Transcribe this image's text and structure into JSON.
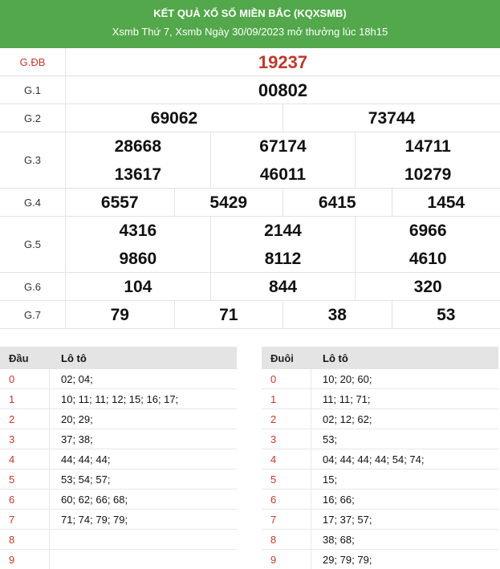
{
  "header": {
    "title": "KẾT QUẢ XỔ SỐ MIỀN BẮC (KQXSMB)",
    "subtitle": "Xsmb Thứ 7, Xsmb Ngày 30/09/2023 mở thưởng lúc 18h15"
  },
  "prizes": [
    {
      "label": "G.ĐB",
      "rows": [
        [
          "19237"
        ]
      ]
    },
    {
      "label": "G.1",
      "rows": [
        [
          "00802"
        ]
      ]
    },
    {
      "label": "G.2",
      "rows": [
        [
          "69062",
          "73744"
        ]
      ]
    },
    {
      "label": "G.3",
      "rows": [
        [
          "28668",
          "67174",
          "14711"
        ],
        [
          "13617",
          "46011",
          "10279"
        ]
      ]
    },
    {
      "label": "G.4",
      "rows": [
        [
          "6557",
          "5429",
          "6415",
          "1454"
        ]
      ]
    },
    {
      "label": "G.5",
      "rows": [
        [
          "4316",
          "2144",
          "6966"
        ],
        [
          "9860",
          "8112",
          "4610"
        ]
      ]
    },
    {
      "label": "G.6",
      "rows": [
        [
          "104",
          "844",
          "320"
        ]
      ]
    },
    {
      "label": "G.7",
      "rows": [
        [
          "79",
          "71",
          "38",
          "53"
        ]
      ]
    }
  ],
  "dau_table": {
    "col1": "Đầu",
    "col2": "Lô tô",
    "rows": [
      {
        "key": "0",
        "value": "02; 04;"
      },
      {
        "key": "1",
        "value": "10; 11; 11; 12; 15; 16; 17;"
      },
      {
        "key": "2",
        "value": "20; 29;"
      },
      {
        "key": "3",
        "value": "37; 38;"
      },
      {
        "key": "4",
        "value": "44; 44; 44;"
      },
      {
        "key": "5",
        "value": "53; 54; 57;"
      },
      {
        "key": "6",
        "value": "60; 62; 66; 68;"
      },
      {
        "key": "7",
        "value": "71; 74; 79; 79;"
      },
      {
        "key": "8",
        "value": ""
      },
      {
        "key": "9",
        "value": ""
      }
    ]
  },
  "duoi_table": {
    "col1": "Đuôi",
    "col2": "Lô tô",
    "rows": [
      {
        "key": "0",
        "value": "10; 20; 60;"
      },
      {
        "key": "1",
        "value": "11; 11; 71;"
      },
      {
        "key": "2",
        "value": "02; 12; 62;"
      },
      {
        "key": "3",
        "value": "53;"
      },
      {
        "key": "4",
        "value": "04; 44; 44; 44; 54; 74;"
      },
      {
        "key": "5",
        "value": "15;"
      },
      {
        "key": "6",
        "value": "16; 66;"
      },
      {
        "key": "7",
        "value": "17; 37; 57;"
      },
      {
        "key": "8",
        "value": "38; 68;"
      },
      {
        "key": "9",
        "value": "29; 79; 79;"
      }
    ]
  },
  "colors": {
    "header_bg": "#52a84a",
    "accent_red": "#c0392b"
  }
}
